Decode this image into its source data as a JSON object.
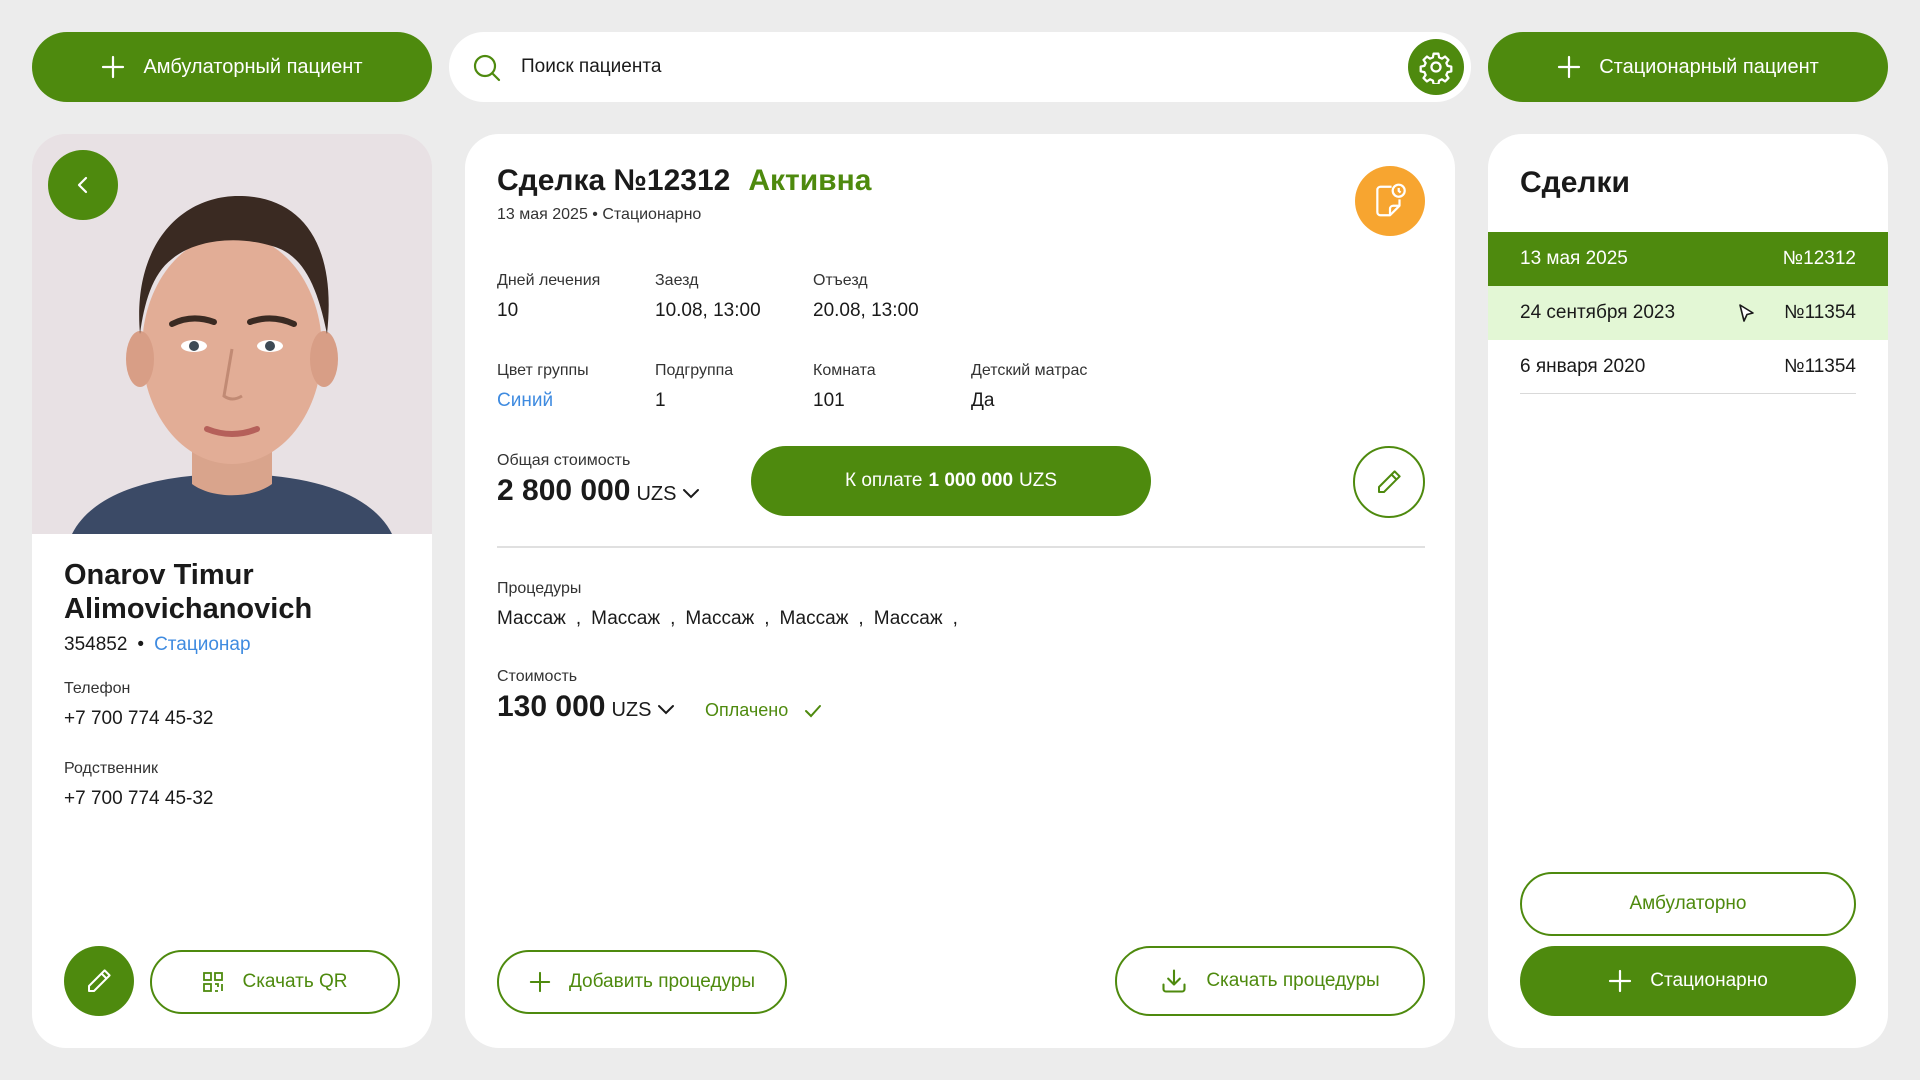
{
  "header": {
    "ambulatory_button": "Амбулаторный пациент",
    "search_placeholder": "Поиск пациента",
    "inpatient_button": "Стационарный пациент"
  },
  "patient": {
    "name_line1": "Onarov Timur",
    "name_line2": "Alimovichanovich",
    "id": "354852",
    "separator": "•",
    "type": "Стационар",
    "phone_label": "Телефон",
    "phone": "+7 700 774 45-32",
    "relative_label": "Родственник",
    "relative_phone": "+7 700 774 45-32",
    "download_qr": "Скачать QR"
  },
  "deal": {
    "title": "Сделка №12312",
    "status": "Активна",
    "subtitle": "13 мая 2025 • Стационарно",
    "fields_row1": [
      {
        "label": "Дней лечения",
        "value": "10"
      },
      {
        "label": "Заезд",
        "value": "10.08, 13:00"
      },
      {
        "label": "Отъезд",
        "value": "20.08, 13:00"
      }
    ],
    "fields_row2": [
      {
        "label": "Цвет группы",
        "value": "Синий"
      },
      {
        "label": "Подгруппа",
        "value": "1"
      },
      {
        "label": "Комната",
        "value": "101"
      },
      {
        "label": "Детский матрас",
        "value": "Да"
      }
    ],
    "total_label": "Общая стоимость",
    "total_value": "2 800 000",
    "currency": "UZS",
    "pay_prefix": "К оплате",
    "pay_amount": "1 000 000",
    "pay_currency": "UZS",
    "procedures_label": "Процедуры",
    "procedures": [
      "Массаж",
      "Массаж",
      "Массаж",
      "Массаж",
      "Массаж"
    ],
    "cost_label": "Стоимость",
    "cost_value": "130 000",
    "cost_currency": "UZS",
    "paid_status": "Оплачено",
    "add_procedures": "Добавить процедуры",
    "download_procedures": "Скачать процедуры"
  },
  "deals_panel": {
    "title": "Сделки",
    "items": [
      {
        "date": "13 мая 2025",
        "number": "№12312"
      },
      {
        "date": "24 сентября 2023",
        "number": "№11354"
      },
      {
        "date": "6 января 2020",
        "number": "№11354"
      }
    ],
    "ambulatory_button": "Амбулаторно",
    "inpatient_button": "Стационарно"
  },
  "colors": {
    "accent": "#4e8a0e",
    "orange": "#f7a530",
    "link": "#3f8be0",
    "hover_row": "#e3f7d5"
  }
}
